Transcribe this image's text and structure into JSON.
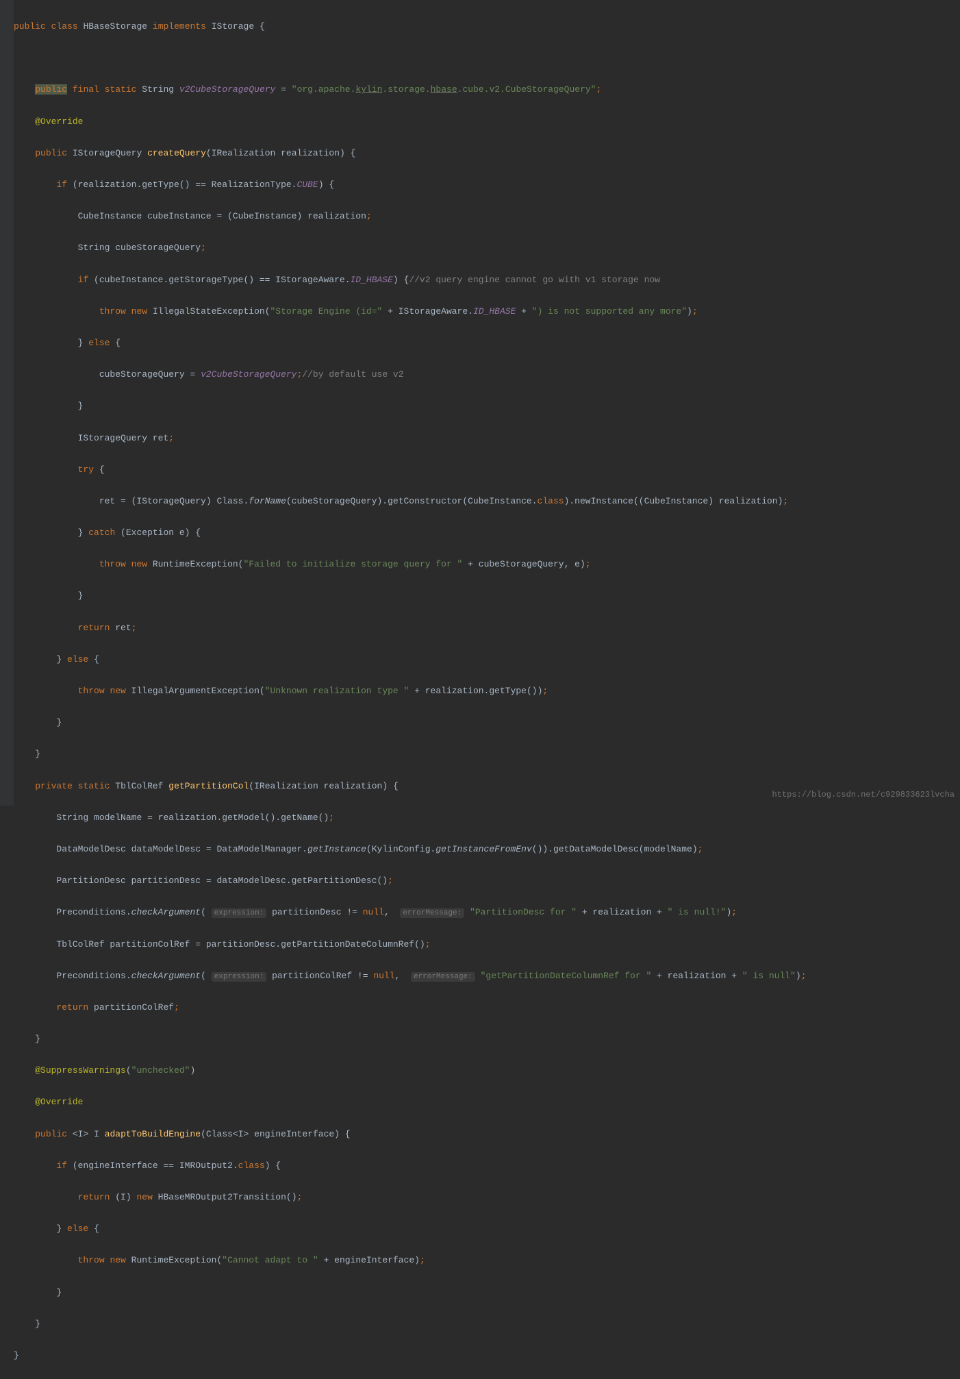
{
  "code": {
    "l1": {
      "kw1": "public",
      "kw2": "class",
      "name": "HBaseStorage",
      "kw3": "implements",
      "iface": "IStorage",
      "brace": " {"
    },
    "l3": {
      "kw1": "public",
      "kw2": "final",
      "kw3": "static",
      "type": "String",
      "field": "v2CubeStorageQuery",
      "eq": " = ",
      "s1": "\"org.apache.",
      "u1": "kylin",
      "s2": ".storage.",
      "u2": "hbase",
      "s3": ".cube.v2.CubeStorageQuery\"",
      "semi": ";"
    },
    "l4": {
      "ann": "@Override"
    },
    "l5": {
      "kw": "public",
      "type": "IStorageQuery",
      "method": "createQuery",
      "params": "(IRealization realization)",
      "brace": " {"
    },
    "l6": {
      "kw": "if",
      "cond": " (realization.getType() == RealizationType.",
      "cube": "CUBE",
      "end": ") {"
    },
    "l7": {
      "txt": "CubeInstance cubeInstance = (CubeInstance) realization",
      "semi": ";"
    },
    "l8": {
      "txt": "String cubeStorageQuery",
      "semi": ";"
    },
    "l9": {
      "kw": "if",
      "cond": " (cubeInstance.getStorageType() == IStorageAware.",
      "fld": "ID_HBASE",
      "end": ") {",
      "cmt": "//v2 query engine cannot go with v1 storage now"
    },
    "l10": {
      "kw1": "throw",
      "kw2": "new",
      "cls": " IllegalStateException(",
      "s1": "\"Storage Engine (id=\"",
      "plus1": " + IStorageAware.",
      "fld": "ID_HBASE",
      "plus2": " + ",
      "s2": "\") is not supported any more\"",
      "end": ")",
      "semi": ";"
    },
    "l11": {
      "brace": "}",
      "kw": "else",
      "brace2": " {"
    },
    "l12": {
      "var": "cubeStorageQuery = ",
      "fld": "v2CubeStorageQuery",
      "semi": ";",
      "cmt": "//by default use v2"
    },
    "l13": {
      "brace": "}"
    },
    "l14": {
      "txt": "IStorageQuery ret",
      "semi": ";"
    },
    "l15": {
      "kw": "try",
      "brace": " {"
    },
    "l16": {
      "txt": "ret = (IStorageQuery) Class.",
      "m": "forName",
      "p1": "(cubeStorageQuery).getConstructor(CubeInstance.",
      "kw": "class",
      "p2": ").newInstance((CubeInstance) realization)",
      "semi": ";"
    },
    "l17": {
      "brace": "} ",
      "kw": "catch",
      "cond": " (Exception e) {"
    },
    "l18": {
      "kw1": "throw",
      "kw2": "new",
      "cls": " RuntimeException(",
      "s": "\"Failed to initialize storage query for \"",
      "plus": " + cubeStorageQuery, e)",
      "semi": ";"
    },
    "l19": {
      "brace": "}"
    },
    "l20": {
      "kw": "return",
      "var": " ret",
      "semi": ";"
    },
    "l21": {
      "brace": "} ",
      "kw": "else",
      "brace2": " {"
    },
    "l22": {
      "kw1": "throw",
      "kw2": "new",
      "cls": " IllegalArgumentException(",
      "s": "\"Unknown realization type \"",
      "plus": " + realization.getType())",
      "semi": ";"
    },
    "l23": {
      "brace": "}"
    },
    "l24": {
      "brace": "}"
    },
    "l25": {
      "kw1": "private",
      "kw2": "static",
      "type": "TblColRef",
      "method": "getPartitionCol",
      "params": "(IRealization realization) {"
    },
    "l26": {
      "txt": "String modelName = realization.getModel().getName()",
      "semi": ";"
    },
    "l27": {
      "txt": "DataModelDesc dataModelDesc = DataModelManager.",
      "m1": "getInstance",
      "p1": "(KylinConfig.",
      "m2": "getInstanceFromEnv",
      "p2": "()).getDataModelDesc(modelName)",
      "semi": ";"
    },
    "l28": {
      "txt": "PartitionDesc partitionDesc = dataModelDesc.getPartitionDesc()",
      "semi": ";"
    },
    "l29": {
      "txt": "Preconditions.",
      "m": "checkArgument",
      "p1": "( ",
      "h1": "expression:",
      "p2": " partitionDesc != ",
      "kw": "null",
      "c": ", ",
      "h2": "errorMessage:",
      "s": " \"PartitionDesc for \"",
      "plus": " + realization + ",
      "s2": "\" is null!\"",
      "end": ")",
      "semi": ";"
    },
    "l30": {
      "txt": "TblColRef partitionColRef = partitionDesc.getPartitionDateColumnRef()",
      "semi": ";"
    },
    "l31": {
      "txt": "Preconditions.",
      "m": "checkArgument",
      "p1": "( ",
      "h1": "expression:",
      "p2": " partitionColRef != ",
      "kw": "null",
      "c": ", ",
      "h2": "errorMessage:",
      "s": " \"getPartitionDateColumnRef for \"",
      "plus": " + realization + ",
      "s2": "\" is null\"",
      "end": ")",
      "semi": ";"
    },
    "l32": {
      "kw": "return",
      "var": " partitionColRef",
      "semi": ";"
    },
    "l33": {
      "brace": "}"
    },
    "l34": {
      "ann": "@SuppressWarnings",
      "p": "(",
      "s": "\"unchecked\"",
      "e": ")"
    },
    "l35": {
      "ann": "@Override"
    },
    "l36": {
      "kw": "public",
      "gen": " <",
      "t": "I",
      "gen2": "> ",
      "t2": "I",
      "sp": " ",
      "method": "adaptToBuildEngine",
      "params": "(Class<",
      "t3": "I",
      "params2": "> engineInterface) {"
    },
    "l37": {
      "kw": "if",
      "cond": " (engineInterface == IMROutput2.",
      "kw2": "class",
      "end": ") {"
    },
    "l38": {
      "kw": "return",
      "p1": " (",
      "t": "I",
      "p2": ") ",
      "kw2": "new",
      "cls": " HBaseMROutput2Transition()",
      "semi": ";"
    },
    "l39": {
      "brace": "} ",
      "kw": "else",
      "brace2": " {"
    },
    "l40": {
      "kw1": "throw",
      "kw2": "new",
      "cls": " RuntimeException(",
      "s": "\"Cannot adapt to \"",
      "plus": " + engineInterface)",
      "semi": ";"
    },
    "l41": {
      "brace": "}"
    },
    "l42": {
      "brace": "}"
    },
    "l43": {
      "brace": "}"
    }
  },
  "watermark": "https://blog.csdn.net/c929833623lvcha"
}
